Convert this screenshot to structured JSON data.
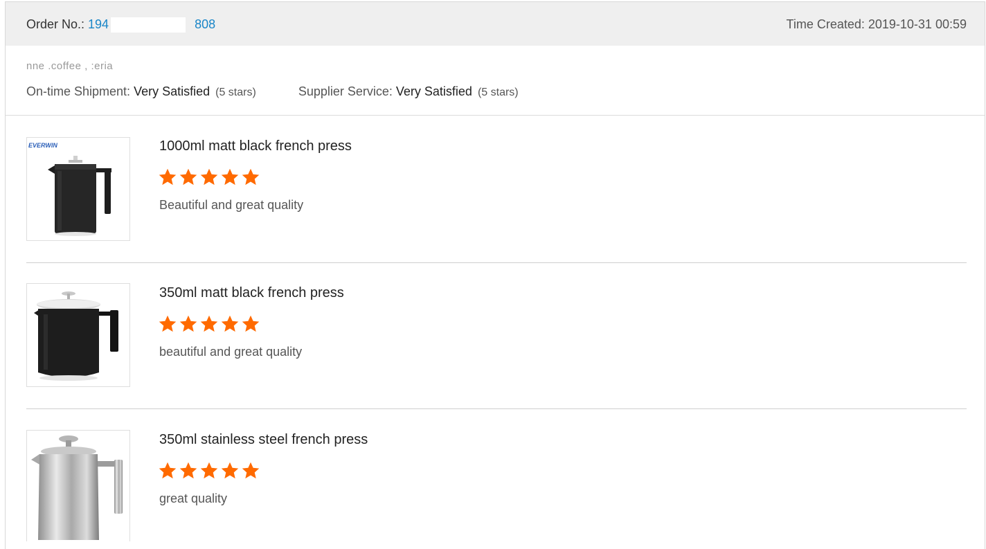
{
  "order": {
    "label": "Order No.: ",
    "number_visible_start": "194",
    "number_visible_end": "808",
    "time_created": "Time Created: 2019-10-31 00:59"
  },
  "buyer": {
    "name_partial": "nne  .coffee ,  :eria"
  },
  "ratings": {
    "shipment_label": "On-time Shipment: ",
    "shipment_value": "Very Satisfied",
    "shipment_stars": "(5 stars)",
    "service_label": "Supplier Service: ",
    "service_value": "Very Satisfied",
    "service_stars": "(5 stars)"
  },
  "items": [
    {
      "title": "1000ml matt black french press",
      "rating": 5,
      "comment": "Beautiful and great quality",
      "image_brand": "EVERWIN",
      "image": "black-tall-french-press"
    },
    {
      "title": "350ml matt black french press",
      "rating": 5,
      "comment": "beautiful and great quality",
      "image": "black-short-french-press"
    },
    {
      "title": "350ml stainless steel french press",
      "rating": 5,
      "comment": "great quality",
      "image": "steel-french-press"
    }
  ],
  "colors": {
    "link": "#1a86c8",
    "star": "#ff6a00",
    "header_bg": "#efefef"
  },
  "icons": [
    "star-icon"
  ]
}
